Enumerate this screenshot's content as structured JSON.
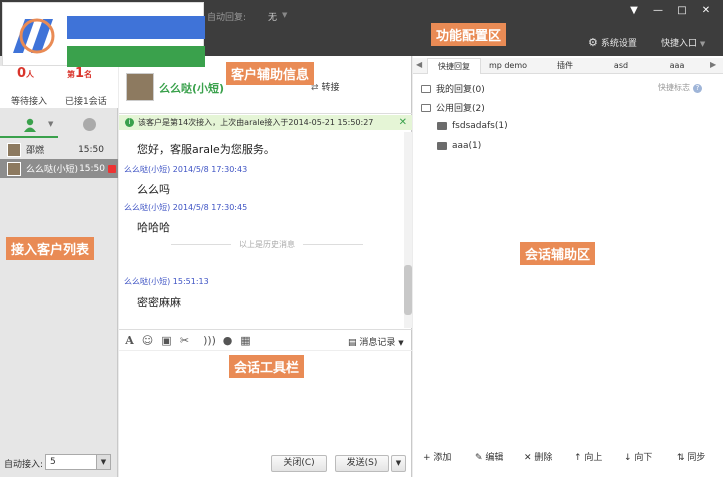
{
  "topbar": {
    "auto_reply_label": "自动回复:",
    "auto_reply_value": "无",
    "settings_label": "系统设置",
    "quick_entry_label": "快捷入口",
    "colors": {
      "bg": "#3d3d3d",
      "logo_blue": "#3f73d8",
      "logo_green": "#3aa14c"
    }
  },
  "annotations": {
    "func_config": "功能配置区",
    "customer_info": "客户辅助信息",
    "customer_list": "接入客户列表",
    "chat_toolbar": "会话工具栏",
    "session_assist": "会话辅助区"
  },
  "left": {
    "waiting_count": "0",
    "waiting_suffix": "人",
    "waiting_label": "等待接入",
    "served_prefix": "第",
    "served_count": "1",
    "served_suffix": "名",
    "served_label": "已接1会话",
    "customers": [
      {
        "name": "邵燃",
        "time": "15:50"
      },
      {
        "name": "么么哒(小短)",
        "time": "15:50"
      }
    ],
    "auto_receive_label": "自动接入:",
    "auto_receive_value": "5"
  },
  "chat": {
    "customer_name": "么么哒(小短)",
    "transfer_label": "转接",
    "notice": "该客户是第14次接入，上次由arale接入于2014-05-21 15:50:27",
    "messages": [
      {
        "body": "您好，客服arale为您服务。"
      },
      {
        "head": "么么哒(小短)  2014/5/8 17:30:43",
        "body": "么么吗"
      },
      {
        "head": "么么哒(小短)  2014/5/8 17:30:45",
        "body": "哈哈哈"
      },
      {
        "head": "么么哒(小短)    15:51:13",
        "body": "密密麻麻"
      }
    ],
    "history_separator": "以上是历史消息",
    "message_record_label": "消息记录",
    "close_button": "关闭(C)",
    "send_button": "发送(S)"
  },
  "right": {
    "tabs": [
      "快捷回复",
      "mp demo",
      "插件",
      "asd",
      "aaa"
    ],
    "quick_mark_label": "快捷标志",
    "tree": {
      "my_replies": "我的回复(0)",
      "public_replies": "公用回复(2)",
      "children": [
        "fsdsadafs(1)",
        "aaa(1)"
      ]
    },
    "actions": [
      "添加",
      "编辑",
      "删除",
      "向上",
      "向下",
      "同步"
    ]
  }
}
